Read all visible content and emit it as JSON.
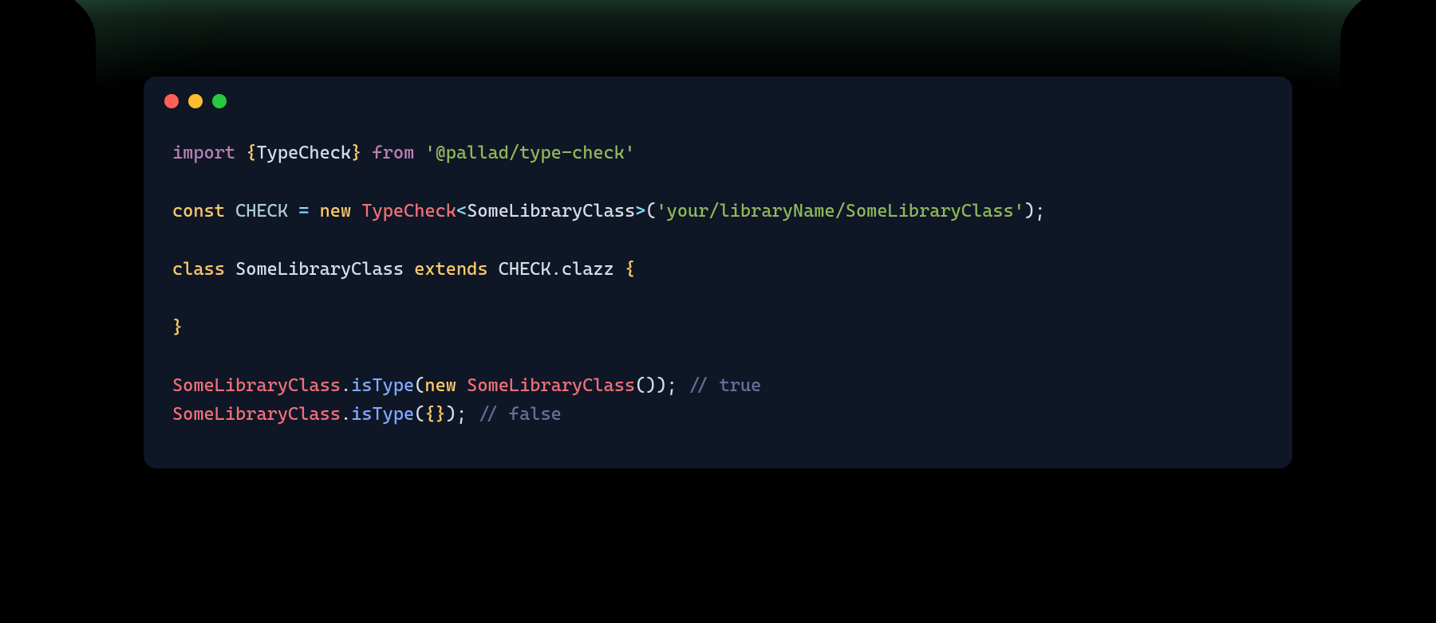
{
  "theme": {
    "card_bg": "#0f1626",
    "traffic_red": "#ff5f56",
    "traffic_yellow": "#ffbd2e",
    "traffic_green": "#27c93f"
  },
  "code": {
    "kw_import": "import",
    "brace_open": "{",
    "import_symbol": "TypeCheck",
    "brace_close": "}",
    "kw_from": "from",
    "import_source": "'@pallad/type-check'",
    "kw_const": "const",
    "const_name": "CHECK",
    "op_eq": "=",
    "kw_new": "new",
    "ctor_name": "TypeCheck",
    "lt": "<",
    "generic_arg": "SomeLibraryClass",
    "gt": ">",
    "paren_open": "(",
    "ctor_arg_string": "'your/libraryName/SomeLibraryClass'",
    "paren_close": ")",
    "semi": ";",
    "kw_class": "class",
    "class_name": "SomeLibraryClass",
    "kw_extends": "extends",
    "extends_target_obj": "CHECK",
    "dot": ".",
    "extends_target_prop": "clazz",
    "class_body_open": "{",
    "class_body_close": "}",
    "call1_obj": "SomeLibraryClass",
    "call1_method": "isType",
    "call1_kw_new": "new",
    "call1_ctor": "SomeLibraryClass",
    "call1_empty_paren": "()",
    "comment_true": "// true",
    "call2_obj": "SomeLibraryClass",
    "call2_method": "isType",
    "call2_arg": "{}",
    "comment_false": "// false"
  }
}
